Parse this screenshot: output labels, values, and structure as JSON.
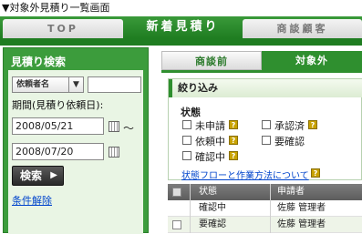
{
  "page": {
    "title": "▼対象外見積り一覧画面"
  },
  "topnav": {
    "tabs": [
      {
        "label": "TOP"
      },
      {
        "label": "新着見積り"
      },
      {
        "label": "商談顧客"
      }
    ]
  },
  "sidebar": {
    "title": "見積り検索",
    "search_field_select": "依頼者名",
    "search_text": "",
    "period_label": "期間(見積り依頼日):",
    "date_from": "2008/05/21",
    "date_to": "2008/07/20",
    "range_separator": "〜",
    "search_button": "検索",
    "clear_link": "条件解除"
  },
  "main": {
    "subtabs": [
      {
        "label": "商談前"
      },
      {
        "label": "対象外"
      }
    ],
    "filter": {
      "heading": "絞り込み",
      "status_label": "状態",
      "options": [
        {
          "label": "未申請",
          "checked": false
        },
        {
          "label": "承認済",
          "checked": false
        },
        {
          "label": "依頼中",
          "checked": false
        },
        {
          "label": "要確認",
          "checked": false
        },
        {
          "label": "確認中",
          "checked": false
        }
      ],
      "help_icon_text": "?",
      "flow_link": "状態フローと作業方法について"
    },
    "table": {
      "headers": {
        "status": "状態",
        "applicant": "申請者"
      },
      "rows": [
        {
          "status": "確認中",
          "applicant": "佐藤 管理者"
        },
        {
          "status": "要確認",
          "applicant": "佐藤 管理者"
        }
      ]
    }
  },
  "colors": {
    "brand_green": "#2f8f2f",
    "link_blue": "#0044cc",
    "help_icon": "#c8a200"
  }
}
